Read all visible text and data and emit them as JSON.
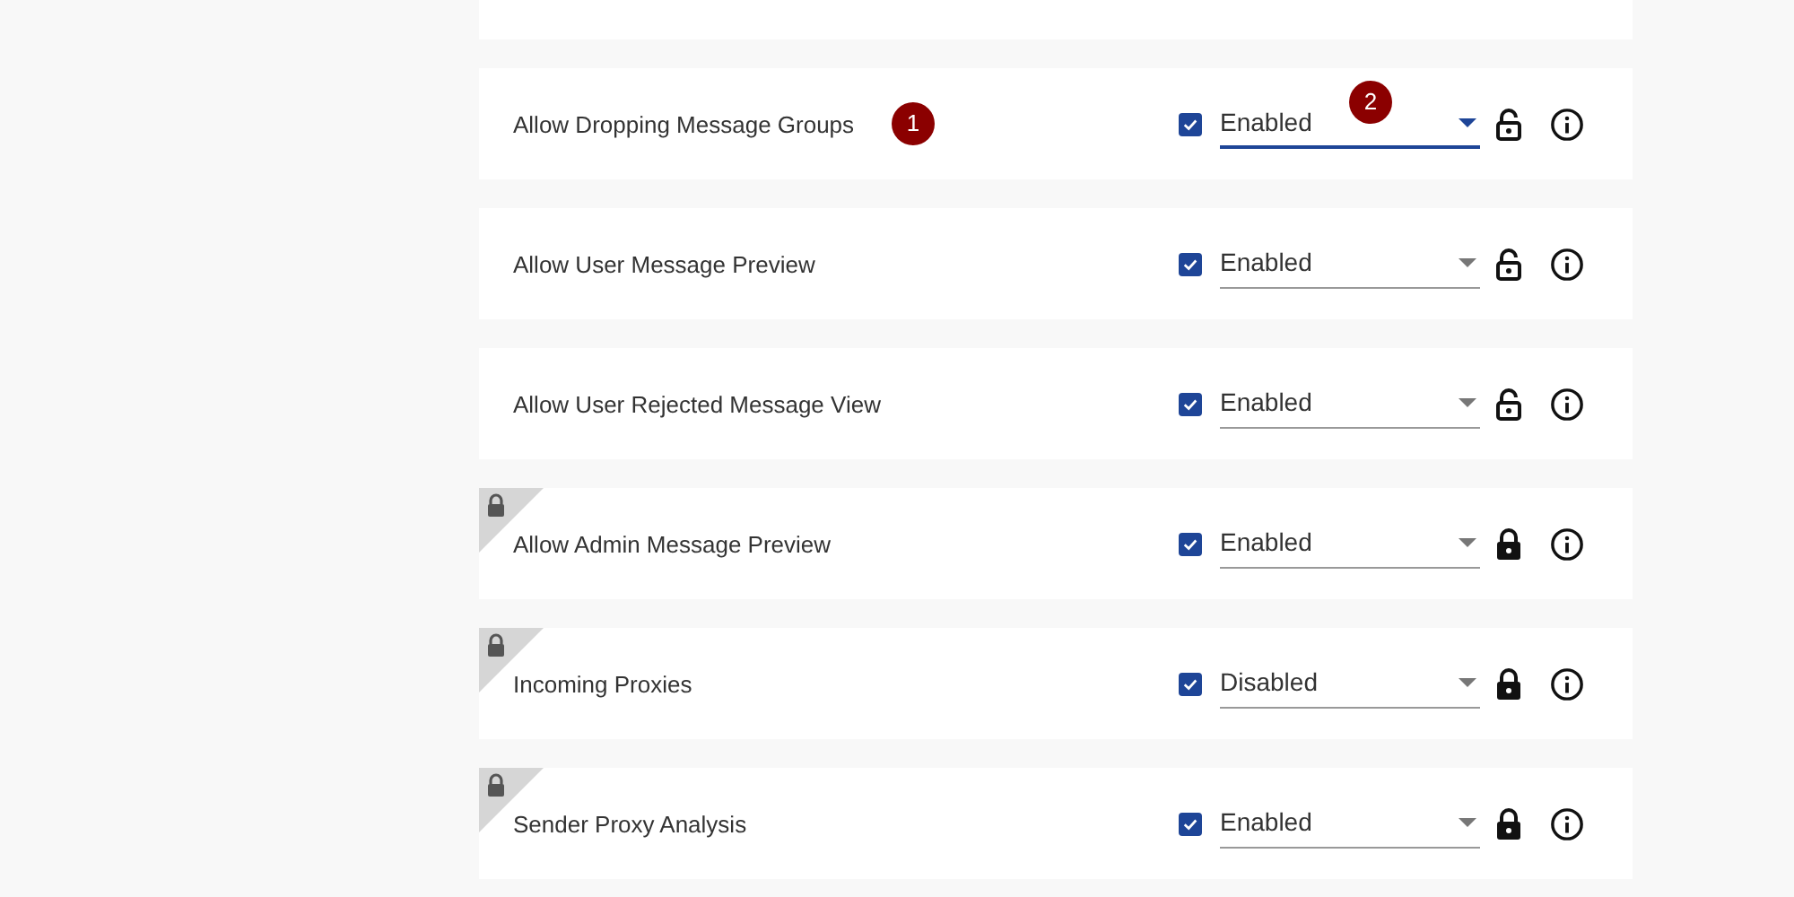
{
  "settings": [
    {
      "label": "Allow Dropping Message Groups",
      "label_callout": "1",
      "checked": true,
      "value": "Enabled",
      "value_callout": "2",
      "focused": true,
      "locked": false
    },
    {
      "label": "Allow User Message Preview",
      "checked": true,
      "value": "Enabled",
      "focused": false,
      "locked": false
    },
    {
      "label": "Allow User Rejected Message View",
      "checked": true,
      "value": "Enabled",
      "focused": false,
      "locked": false
    },
    {
      "label": "Allow Admin Message Preview",
      "checked": true,
      "value": "Enabled",
      "focused": false,
      "locked": true
    },
    {
      "label": "Incoming Proxies",
      "checked": true,
      "value": "Disabled",
      "focused": false,
      "locked": true
    },
    {
      "label": "Sender Proxy Analysis",
      "checked": true,
      "value": "Enabled",
      "focused": false,
      "locked": true
    }
  ]
}
